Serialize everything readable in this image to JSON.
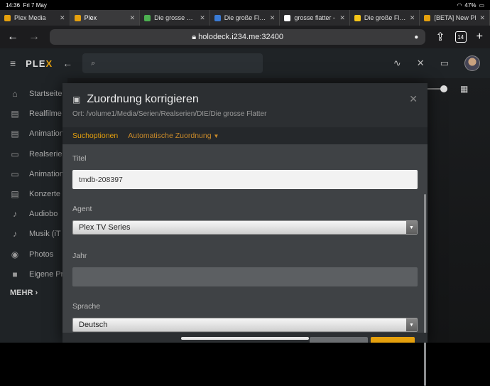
{
  "status": {
    "time": "14:36",
    "date": "Fri 7 May",
    "battery": "47%"
  },
  "tabs": [
    {
      "title": "Plex Media",
      "color": "#e5a00d",
      "active": false
    },
    {
      "title": "Plex",
      "color": "#e5a00d",
      "active": true
    },
    {
      "title": "Die grosse Flatt",
      "color": "#4caf50",
      "active": false
    },
    {
      "title": "Die große Flatt",
      "color": "#3a7bd5",
      "active": false
    },
    {
      "title": "grosse flatter -",
      "color": "#ffffff",
      "active": false
    },
    {
      "title": "Die große Flatt",
      "color": "#f5c518",
      "active": false
    },
    {
      "title": "[BETA] New Pl",
      "color": "#e5a00d",
      "active": false
    }
  ],
  "browser": {
    "url": "holodeck.i234.me:32400",
    "tab_count": "14"
  },
  "plex": {
    "logo_a": "PLE",
    "logo_b": "X"
  },
  "sidebar": {
    "items": [
      {
        "label": "Startseite",
        "icon": "home-icon"
      },
      {
        "label": "Realfilme",
        "icon": "film-icon"
      },
      {
        "label": "Animation",
        "icon": "film-icon"
      },
      {
        "label": "Realserien",
        "icon": "tv-icon"
      },
      {
        "label": "Animation",
        "icon": "tv-icon"
      },
      {
        "label": "Konzerte",
        "icon": "film-icon"
      },
      {
        "label": "Audiobo",
        "icon": "music-icon"
      },
      {
        "label": "Musik (iT",
        "icon": "music-icon"
      },
      {
        "label": "Photos",
        "icon": "camera-icon"
      },
      {
        "label": "Eigene Pr",
        "icon": "video-icon"
      }
    ],
    "more": "MEHR ›"
  },
  "modal": {
    "title": "Zuordnung korrigieren",
    "path": "Ort: /volume1/Media/Serien/Realserien/DIE/Die grosse Flatter",
    "tab_search": "Suchoptionen",
    "tab_auto": "Automatische Zuordnung",
    "title_label": "Titel",
    "title_value": "tmdb-208397",
    "agent_label": "Agent",
    "agent_value": "Plex TV Series",
    "year_label": "Jahr",
    "year_value": "",
    "lang_label": "Sprache",
    "lang_value": "Deutsch"
  },
  "colors": {
    "accent": "#e5a00d"
  }
}
